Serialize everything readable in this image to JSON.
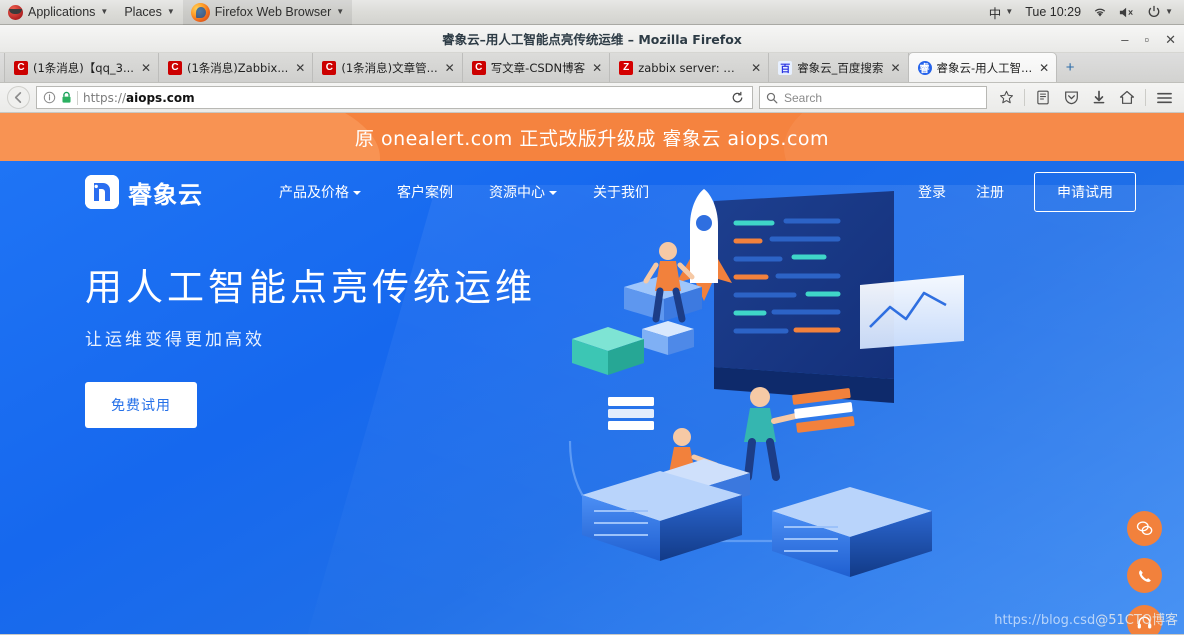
{
  "desktop": {
    "applications_label": "Applications",
    "places_label": "Places",
    "active_app_label": "Firefox Web Browser",
    "input_method": "中",
    "clock": "Tue 10:29",
    "icons": {
      "gnome": "gnome-logo-icon",
      "firefox": "firefox-logo-icon",
      "network": "wifi-icon",
      "volume": "volume-muted-icon",
      "power": "power-icon",
      "menu_caret": "chevron-down-icon"
    }
  },
  "window": {
    "title": "睿象云–用人工智能点亮传统运维 – Mozilla Firefox",
    "controls": {
      "minimize": "–",
      "maximize": "▫",
      "close": "✕"
    }
  },
  "tabs": [
    {
      "favicon": "csdn-icon",
      "favicon_text": "C",
      "title": "(1条消息)【qq_3...",
      "close": "✕",
      "selected": false
    },
    {
      "favicon": "csdn-icon",
      "favicon_text": "C",
      "title": "(1条消息)Zabbix...",
      "close": "✕",
      "selected": false
    },
    {
      "favicon": "csdn-icon",
      "favicon_text": "C",
      "title": "(1条消息)文章管...",
      "close": "✕",
      "selected": false
    },
    {
      "favicon": "csdn-icon",
      "favicon_text": "C",
      "title": "写文章-CSDN博客",
      "close": "✕",
      "selected": false
    },
    {
      "favicon": "zabbix-icon",
      "favicon_text": "Z",
      "title": "zabbix server: 配...",
      "close": "✕",
      "selected": false
    },
    {
      "favicon": "baidu-icon",
      "favicon_text": "百",
      "title": "睿象云_百度搜索",
      "close": "✕",
      "selected": false
    },
    {
      "favicon": "aiops-icon",
      "favicon_text": "睿",
      "title": "睿象云-用人工智...",
      "close": "✕",
      "selected": true
    }
  ],
  "new_tab_button": "+",
  "toolbar": {
    "back_icon": "back-arrow-icon",
    "site_info_icon": "info-icon",
    "lock_icon": "padlock-icon",
    "url_prefix": "https://",
    "url_host": "aiops.com",
    "reload_icon": "reload-icon",
    "search_placeholder": "Search",
    "search_icon": "search-icon",
    "icons": [
      "bookmark-star-icon",
      "library-icon",
      "pocket-icon",
      "downloads-icon",
      "home-icon",
      "hamburger-menu-icon"
    ]
  },
  "promo_banner": {
    "text": "原 onealert.com 正式改版升级成 睿象云 aiops.com",
    "background_color": "#f5833f",
    "text_color": "#ffffff"
  },
  "site_nav": {
    "brand_name": "睿象云",
    "brand_logo_icon": "aiops-elephant-logo-icon",
    "links": [
      {
        "label": "产品及价格",
        "has_dropdown": true
      },
      {
        "label": "客户案例",
        "has_dropdown": false
      },
      {
        "label": "资源中心",
        "has_dropdown": true
      },
      {
        "label": "关于我们",
        "has_dropdown": false
      }
    ],
    "login_label": "登录",
    "register_label": "注册",
    "trial_label": "申请试用"
  },
  "hero": {
    "title": "用人工智能点亮传统运维",
    "subtitle": "让运维变得更加高效",
    "cta_label": "免费试用",
    "background_color": "#1a6cf0"
  },
  "side_actions": [
    {
      "icon": "wechat-icon",
      "glyph": "✇"
    },
    {
      "icon": "phone-icon",
      "glyph": "✆"
    },
    {
      "icon": "headset-support-icon",
      "glyph": "☊"
    }
  ],
  "watermark": {
    "url_text": "https://blog.csd",
    "brand_text": "@51CTO博客"
  }
}
